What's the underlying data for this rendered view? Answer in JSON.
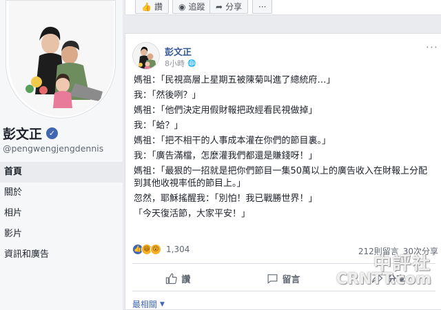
{
  "profile": {
    "name": "彭文正",
    "handle": "@pengwengjengdennis"
  },
  "nav": {
    "items": [
      {
        "label": "首頁",
        "active": true
      },
      {
        "label": "關於"
      },
      {
        "label": "相片"
      },
      {
        "label": "影片"
      },
      {
        "label": "資訊和廣告"
      }
    ]
  },
  "topbar": {
    "like_label": "讚",
    "follow_label": "追蹤",
    "share_label": "分享",
    "more_label": "···"
  },
  "post": {
    "author": "彭文正",
    "time": "8小時",
    "more_label": "···",
    "lines": [
      "媽祖：「民視高層上星期五被陳菊叫進了總統府…」",
      "我：「然後咧？」",
      "媽祖：「他們決定用假財報把政經看民視做掉」",
      "我：「蛤？」",
      "媽祖：「把不相干的人事成本灌在你們的節目裏。」",
      "我：「廣告滿檔，怎麼灌我們都還是賺錢呀！」",
      "媽祖：「最狠的一招就是把你們節目一集50萬以上的廣告收入在財報上分配到其他收視率低的節目上。」",
      "忽然，耶穌搖醒我：「別怕！我已戰勝世界！」",
      "「今天復活節，大家平安！」"
    ],
    "reaction_count": "1,304",
    "comment_count": "212則留言",
    "share_count": "30次分享",
    "actions": {
      "like": "讚",
      "comment": "留言",
      "share": "分享"
    },
    "sort_label": "最相關"
  },
  "watermark": {
    "cn": "中評社",
    "en": "CRNTT.com"
  },
  "colors": {
    "brand": "#4267b2",
    "link": "#365899"
  }
}
